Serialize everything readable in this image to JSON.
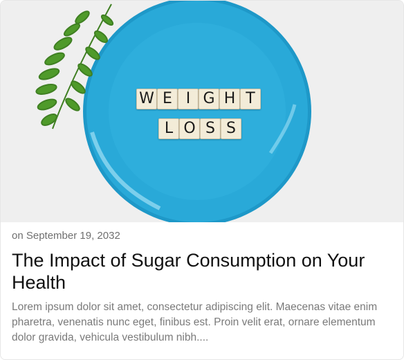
{
  "image": {
    "alt_description": "",
    "tile_words": [
      "WEIGHT",
      "LOSS"
    ],
    "colors": {
      "background": "#efefef",
      "plate": "#29a9d8",
      "fern": "#4f9a2a"
    }
  },
  "post": {
    "date": "on September 19, 2032",
    "title": "The Impact of Sugar Consumption on Your Health",
    "excerpt": "Lorem ipsum dolor sit amet, consectetur adipiscing elit. Maecenas vitae enim pharetra, venenatis nunc eget, finibus est. Proin velit erat, ornare elementum dolor gravida, vehicula vestibulum nibh...."
  }
}
